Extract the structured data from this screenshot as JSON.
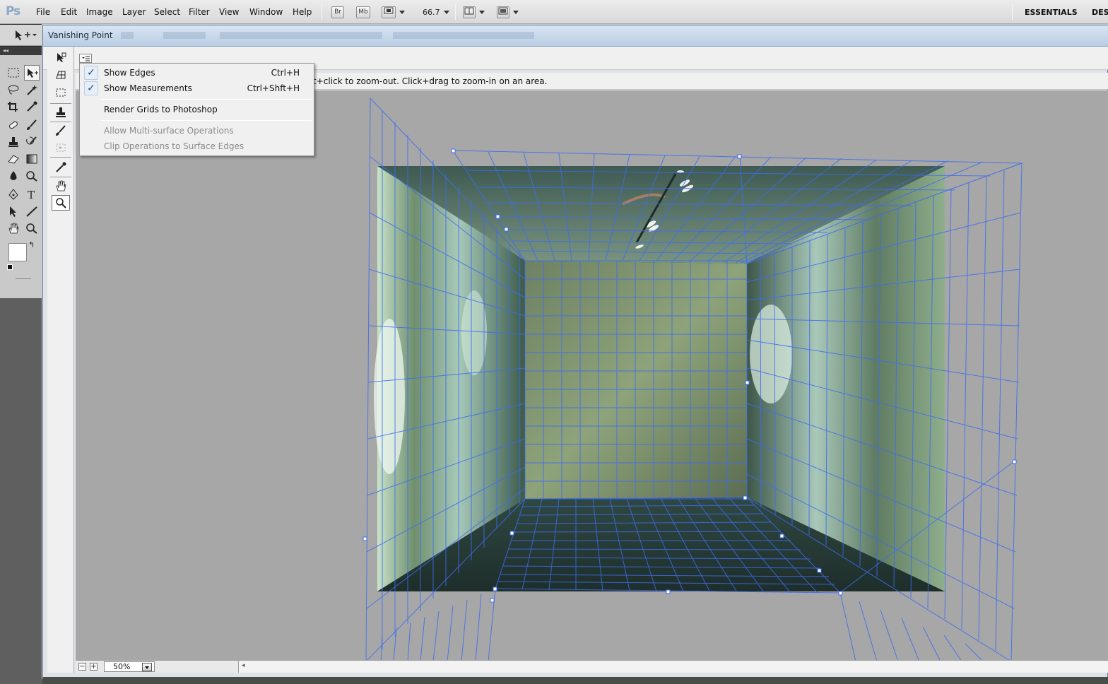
{
  "app": {
    "logo": "Ps",
    "menu": [
      "File",
      "Edit",
      "Image",
      "Layer",
      "Select",
      "Filter",
      "View",
      "Window",
      "Help"
    ],
    "bridge_label": "Br",
    "minibridge_label": "Mb",
    "zoom_value": "66.7",
    "workspace": "ESSENTIALS",
    "workspace_next": "DES"
  },
  "dialog": {
    "title": "Vanishing Point",
    "hint_text": "t+click to zoom-out. Click+drag to zoom-in on an area.",
    "zoom": "50%"
  },
  "settings_menu": {
    "items": [
      {
        "label": "Show Edges",
        "shortcut": "Ctrl+H",
        "checked": true,
        "enabled": true
      },
      {
        "label": "Show Measurements",
        "shortcut": "Ctrl+Shft+H",
        "checked": true,
        "enabled": true
      },
      {
        "label": "Render Grids to Photoshop",
        "shortcut": "",
        "checked": false,
        "enabled": true
      },
      {
        "label": "Allow Multi-surface Operations",
        "shortcut": "",
        "checked": false,
        "enabled": false
      },
      {
        "label": "Clip Operations to Surface Edges",
        "shortcut": "",
        "checked": false,
        "enabled": false
      }
    ]
  },
  "vp_tools": [
    {
      "name": "edit-plane-tool-icon"
    },
    {
      "name": "create-plane-tool-icon"
    },
    {
      "name": "marquee-tool-icon"
    },
    {
      "name": "stamp-tool-icon"
    },
    {
      "name": "brush-tool-icon"
    },
    {
      "name": "transform-tool-icon"
    },
    {
      "name": "eyedropper-tool-icon"
    },
    {
      "name": "hand-tool-icon"
    },
    {
      "name": "zoom-tool-icon"
    }
  ],
  "colors": {
    "grid": "#3d6cf0",
    "canvas": "#a7a7a7",
    "wall": "#8aa374",
    "floor": "#2a3a35"
  }
}
